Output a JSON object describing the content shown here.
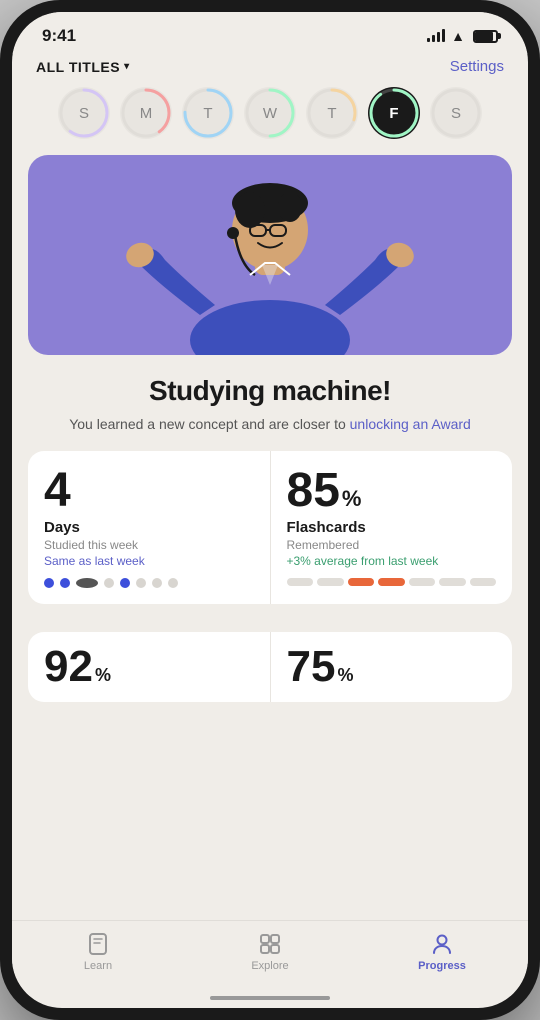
{
  "statusBar": {
    "time": "9:41"
  },
  "header": {
    "allTitles": "ALL TITLES",
    "settings": "Settings"
  },
  "days": [
    {
      "letter": "S",
      "progress": 0.6,
      "active": false,
      "color": "#d4c5f5"
    },
    {
      "letter": "M",
      "progress": 0.4,
      "active": false,
      "color": "#f5a0a0"
    },
    {
      "letter": "T",
      "progress": 0.75,
      "active": false,
      "color": "#a0d4f5"
    },
    {
      "letter": "W",
      "progress": 0.5,
      "active": false,
      "color": "#a0f5c5"
    },
    {
      "letter": "T",
      "progress": 0.3,
      "active": false,
      "color": "#f5d4a0"
    },
    {
      "letter": "F",
      "progress": 0.9,
      "active": true,
      "color": "#1a1a1a"
    },
    {
      "letter": "S",
      "progress": 0,
      "active": false,
      "color": "#d0d0d0"
    }
  ],
  "hero": {
    "title": "Studying machine!",
    "subtitle": "You learned a new concept and are closer to",
    "highlight": "unlocking an Award"
  },
  "stats": {
    "left": {
      "number": "4",
      "label": "Days",
      "sublabel": "Studied this week",
      "change": "Same as last week"
    },
    "right": {
      "number": "85",
      "percent": "%",
      "label": "Flashcards",
      "sublabel": "Remembered",
      "change": "+3% average from last week"
    }
  },
  "stats2": {
    "left": {
      "number": "92",
      "percent": "%"
    },
    "right": {
      "number": "75",
      "percent": "%"
    }
  },
  "nav": {
    "items": [
      {
        "label": "Learn",
        "active": false
      },
      {
        "label": "Explore",
        "active": false
      },
      {
        "label": "Progress",
        "active": true
      }
    ]
  }
}
